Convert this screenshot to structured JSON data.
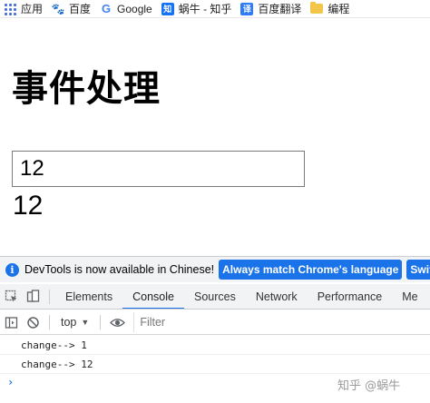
{
  "bookmarks": [
    {
      "label": "应用",
      "icon": "apps-grid-icon"
    },
    {
      "label": "百度",
      "icon": "baidu-paw-icon"
    },
    {
      "label": "Google",
      "icon": "google-g-icon"
    },
    {
      "label": "蜗牛 - 知乎",
      "icon": "zhihu-icon",
      "icon_text": "知"
    },
    {
      "label": "百度翻译",
      "icon": "translate-icon",
      "icon_text": "译"
    },
    {
      "label": "编程",
      "icon": "folder-icon"
    }
  ],
  "page": {
    "title": "事件处理",
    "input_value": "12",
    "echo_text": "12"
  },
  "devtools": {
    "info_text": "DevTools is now available in Chinese!",
    "info_button": "Always match Chrome's language",
    "info_button2": "Switc",
    "tabs": [
      "Elements",
      "Console",
      "Sources",
      "Network",
      "Performance",
      "Me"
    ],
    "active_tab": "Console",
    "context": "top",
    "filter_placeholder": "Filter",
    "logs": [
      "change--> 1",
      "change--> 12"
    ],
    "prompt": "›"
  },
  "watermark": "知乎 @蜗牛",
  "colors": {
    "accent": "#1a73e8",
    "infobar_bg": "#f1f3f4"
  }
}
